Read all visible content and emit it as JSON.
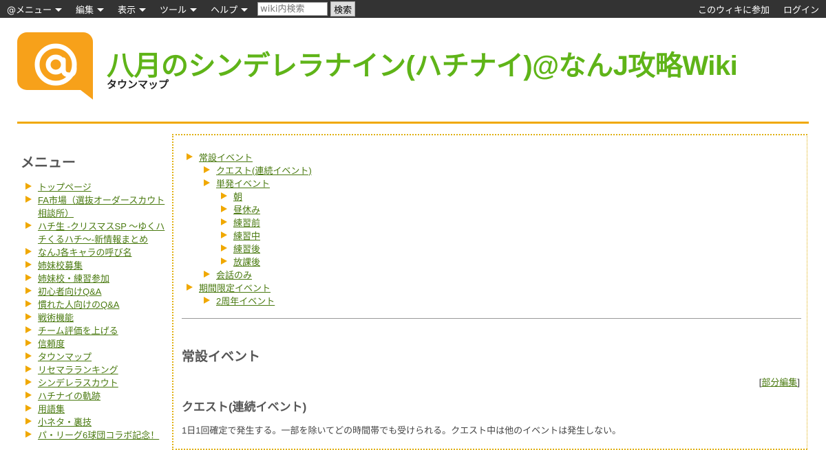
{
  "topbar": {
    "menus": [
      {
        "label": "@メニュー"
      },
      {
        "label": "編集"
      },
      {
        "label": "表示"
      },
      {
        "label": "ツール"
      },
      {
        "label": "ヘルプ"
      }
    ],
    "search_placeholder": "wiki内検索",
    "search_button": "検索",
    "join_label": "このウィキに参加",
    "login_label": "ログイン"
  },
  "header": {
    "site_title": "八月のシンデレラナイン(ハチナイ)@なんJ攻略Wiki",
    "page_title": "タウンマップ",
    "logo_color": "#f7a11a"
  },
  "sidebar": {
    "title": "メニュー",
    "items": [
      "トップページ",
      "FA市場（選抜オーダースカウト相談所）",
      "ハチ生 -クリスマスSP 〜ゆくハチくるハチ〜-新情報まとめ",
      "なんJ各キャラの呼び名",
      "姉妹校募集",
      "姉妹校・練習参加",
      "初心者向けQ&A",
      "慣れた人向けのQ&A",
      "戦術機能",
      "チーム評価を上げる",
      "信頼度",
      "タウンマップ",
      "リセマラランキング",
      "シンデレラスカウト",
      "ハチナイの軌跡",
      "用語集",
      "小ネタ・裏技",
      "パ・リーグ6球団コラボ記念！"
    ]
  },
  "toc": [
    {
      "label": "常設イベント",
      "level": 0
    },
    {
      "label": "クエスト(連続イベント)",
      "level": 1
    },
    {
      "label": "単発イベント",
      "level": 1
    },
    {
      "label": "朝",
      "level": 2
    },
    {
      "label": "昼休み",
      "level": 2
    },
    {
      "label": "練習前",
      "level": 2
    },
    {
      "label": "練習中",
      "level": 2
    },
    {
      "label": "練習後",
      "level": 2
    },
    {
      "label": "放課後",
      "level": 2
    },
    {
      "label": "会話のみ",
      "level": 1
    },
    {
      "label": "期間限定イベント",
      "level": 0
    },
    {
      "label": "2周年イベント",
      "level": 1
    }
  ],
  "content": {
    "section_heading": "常設イベント",
    "edit_link": "部分編集",
    "sub_heading": "クエスト(連続イベント)",
    "description": "1日1回確定で発生する。一部を除いてどの時間帯でも受けられる。クエスト中は他のイベントは発生しない。"
  },
  "colors": {
    "title_green": "#5fb418",
    "accent_orange": "#f0a800",
    "link_green": "#4a7a10",
    "topbar_bg": "#333333"
  }
}
